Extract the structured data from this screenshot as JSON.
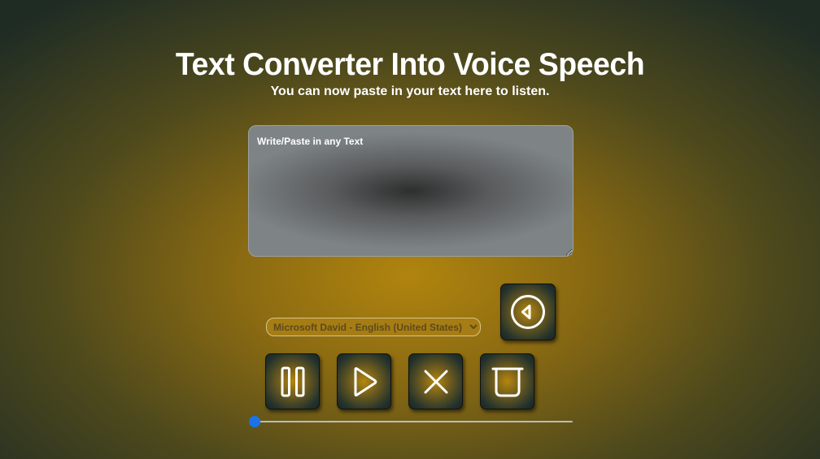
{
  "header": {
    "title": "Text Converter Into Voice Speech",
    "subtitle": "You can now paste in your text here to listen."
  },
  "text_input": {
    "placeholder": "Write/Paste in any Text",
    "value": ""
  },
  "voice_select": {
    "selected": "Microsoft David - English (United States)",
    "options": [
      "Microsoft David - English (United States)"
    ]
  },
  "controls": {
    "back_icon": "circle-back-icon",
    "pause_icon": "pause-icon",
    "play_icon": "play-icon",
    "stop_icon": "close-icon",
    "clear_icon": "clear-cup-icon"
  },
  "progress_slider": {
    "value": 0
  },
  "colors": {
    "accent": "#1a73e8",
    "icon": "#ffffff"
  }
}
